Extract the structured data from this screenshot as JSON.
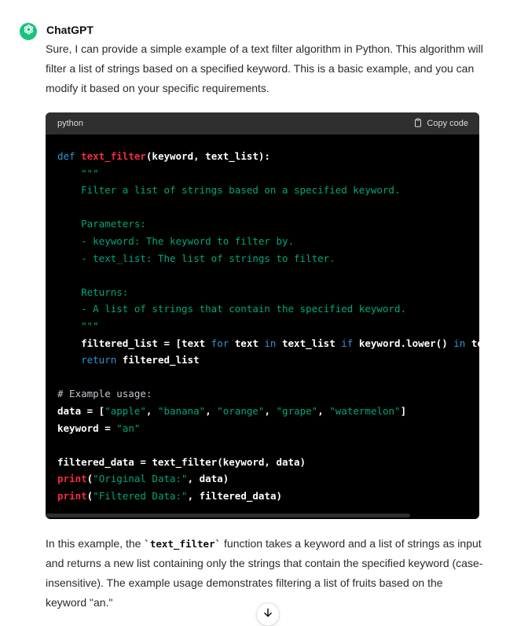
{
  "author": "ChatGPT",
  "intro": "Sure, I can provide a simple example of a text filter algorithm in Python. This algorithm will filter a list of strings based on a specified keyword. This is a basic example, and you can modify it based on your specific requirements.",
  "code": {
    "language": "python",
    "copy_label": "Copy code",
    "lines": [
      [
        [
          "kw",
          "def "
        ],
        [
          "fn",
          "text_filter"
        ],
        [
          "",
          "(keyword, text_list):"
        ]
      ],
      [
        [
          "str",
          "    \"\"\""
        ]
      ],
      [
        [
          "str",
          "    Filter a list of strings based on a specified keyword."
        ]
      ],
      [],
      [
        [
          "str",
          "    Parameters:"
        ]
      ],
      [
        [
          "str",
          "    - keyword: The keyword to filter by."
        ]
      ],
      [
        [
          "str",
          "    - text_list: The list of strings to filter."
        ]
      ],
      [],
      [
        [
          "str",
          "    Returns:"
        ]
      ],
      [
        [
          "str",
          "    - A list of strings that contain the specified keyword."
        ]
      ],
      [
        [
          "str",
          "    \"\"\""
        ]
      ],
      [
        [
          "",
          "    filtered_list = [text "
        ],
        [
          "kw",
          "for"
        ],
        [
          "",
          " text "
        ],
        [
          "kw",
          "in"
        ],
        [
          "",
          " text_list "
        ],
        [
          "kw",
          "if"
        ],
        [
          "",
          " keyword.lower() "
        ],
        [
          "kw",
          "in"
        ],
        [
          "",
          " text.lower()]"
        ]
      ],
      [
        [
          "kw",
          "    return"
        ],
        [
          "",
          " filtered_list"
        ]
      ],
      [],
      [
        [
          "cm",
          "# Example usage:"
        ]
      ],
      [
        [
          "",
          "data = ["
        ],
        [
          "str",
          "\"apple\""
        ],
        [
          "",
          ", "
        ],
        [
          "str",
          "\"banana\""
        ],
        [
          "",
          ", "
        ],
        [
          "str",
          "\"orange\""
        ],
        [
          "",
          ", "
        ],
        [
          "str",
          "\"grape\""
        ],
        [
          "",
          ", "
        ],
        [
          "str",
          "\"watermelon\""
        ],
        [
          "",
          "]"
        ]
      ],
      [
        [
          "",
          "keyword = "
        ],
        [
          "str",
          "\"an\""
        ]
      ],
      [],
      [
        [
          "",
          "filtered_data = text_filter(keyword, data)"
        ]
      ],
      [
        [
          "fn",
          "print"
        ],
        [
          "",
          "("
        ],
        [
          "str",
          "\"Original Data:\""
        ],
        [
          "",
          ", data)"
        ]
      ],
      [
        [
          "fn",
          "print"
        ],
        [
          "",
          "("
        ],
        [
          "str",
          "\"Filtered Data:\""
        ],
        [
          "",
          ", filtered_data)"
        ]
      ]
    ]
  },
  "outro": {
    "before": "In this example, the ",
    "code": "`text_filter`",
    "after": " function takes a keyword and a list of strings as input and returns a new list containing only the strings that contain the specified keyword (case-insensitive). The example usage demonstrates filtering a list of fruits based on the keyword \"an.\""
  },
  "icons": {
    "avatar": "openai-logo-icon",
    "copy": "clipboard-icon",
    "scroll": "arrow-down-icon"
  },
  "colors": {
    "avatar_bg": "#19c37d",
    "keyword": "#2e95d3",
    "function": "#f22c3d",
    "string": "#00a67d",
    "comment": "#c5c5d2"
  }
}
